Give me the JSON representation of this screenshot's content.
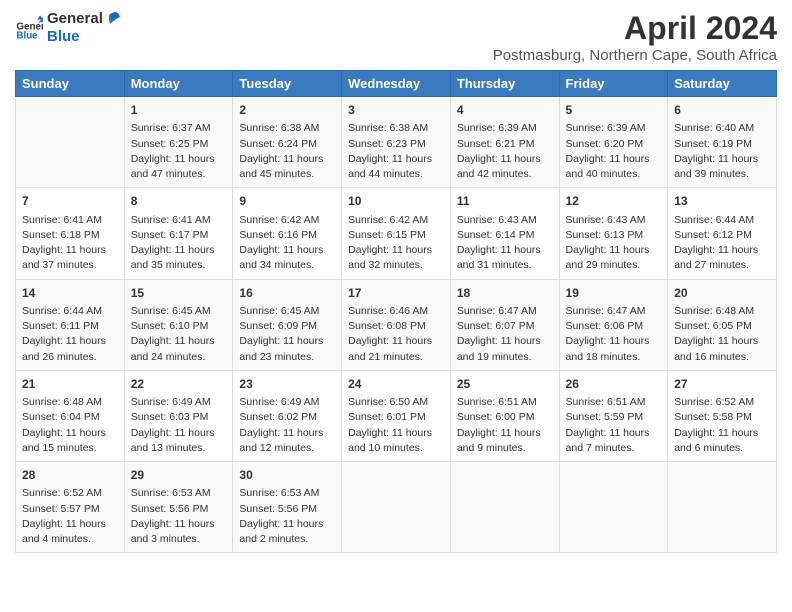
{
  "logo": {
    "text_general": "General",
    "text_blue": "Blue"
  },
  "title": "April 2024",
  "subtitle": "Postmasburg, Northern Cape, South Africa",
  "days_of_week": [
    "Sunday",
    "Monday",
    "Tuesday",
    "Wednesday",
    "Thursday",
    "Friday",
    "Saturday"
  ],
  "weeks": [
    [
      {
        "day": "",
        "info": ""
      },
      {
        "day": "1",
        "info": "Sunrise: 6:37 AM\nSunset: 6:25 PM\nDaylight: 11 hours\nand 47 minutes."
      },
      {
        "day": "2",
        "info": "Sunrise: 6:38 AM\nSunset: 6:24 PM\nDaylight: 11 hours\nand 45 minutes."
      },
      {
        "day": "3",
        "info": "Sunrise: 6:38 AM\nSunset: 6:23 PM\nDaylight: 11 hours\nand 44 minutes."
      },
      {
        "day": "4",
        "info": "Sunrise: 6:39 AM\nSunset: 6:21 PM\nDaylight: 11 hours\nand 42 minutes."
      },
      {
        "day": "5",
        "info": "Sunrise: 6:39 AM\nSunset: 6:20 PM\nDaylight: 11 hours\nand 40 minutes."
      },
      {
        "day": "6",
        "info": "Sunrise: 6:40 AM\nSunset: 6:19 PM\nDaylight: 11 hours\nand 39 minutes."
      }
    ],
    [
      {
        "day": "7",
        "info": "Sunrise: 6:41 AM\nSunset: 6:18 PM\nDaylight: 11 hours\nand 37 minutes."
      },
      {
        "day": "8",
        "info": "Sunrise: 6:41 AM\nSunset: 6:17 PM\nDaylight: 11 hours\nand 35 minutes."
      },
      {
        "day": "9",
        "info": "Sunrise: 6:42 AM\nSunset: 6:16 PM\nDaylight: 11 hours\nand 34 minutes."
      },
      {
        "day": "10",
        "info": "Sunrise: 6:42 AM\nSunset: 6:15 PM\nDaylight: 11 hours\nand 32 minutes."
      },
      {
        "day": "11",
        "info": "Sunrise: 6:43 AM\nSunset: 6:14 PM\nDaylight: 11 hours\nand 31 minutes."
      },
      {
        "day": "12",
        "info": "Sunrise: 6:43 AM\nSunset: 6:13 PM\nDaylight: 11 hours\nand 29 minutes."
      },
      {
        "day": "13",
        "info": "Sunrise: 6:44 AM\nSunset: 6:12 PM\nDaylight: 11 hours\nand 27 minutes."
      }
    ],
    [
      {
        "day": "14",
        "info": "Sunrise: 6:44 AM\nSunset: 6:11 PM\nDaylight: 11 hours\nand 26 minutes."
      },
      {
        "day": "15",
        "info": "Sunrise: 6:45 AM\nSunset: 6:10 PM\nDaylight: 11 hours\nand 24 minutes."
      },
      {
        "day": "16",
        "info": "Sunrise: 6:45 AM\nSunset: 6:09 PM\nDaylight: 11 hours\nand 23 minutes."
      },
      {
        "day": "17",
        "info": "Sunrise: 6:46 AM\nSunset: 6:08 PM\nDaylight: 11 hours\nand 21 minutes."
      },
      {
        "day": "18",
        "info": "Sunrise: 6:47 AM\nSunset: 6:07 PM\nDaylight: 11 hours\nand 19 minutes."
      },
      {
        "day": "19",
        "info": "Sunrise: 6:47 AM\nSunset: 6:06 PM\nDaylight: 11 hours\nand 18 minutes."
      },
      {
        "day": "20",
        "info": "Sunrise: 6:48 AM\nSunset: 6:05 PM\nDaylight: 11 hours\nand 16 minutes."
      }
    ],
    [
      {
        "day": "21",
        "info": "Sunrise: 6:48 AM\nSunset: 6:04 PM\nDaylight: 11 hours\nand 15 minutes."
      },
      {
        "day": "22",
        "info": "Sunrise: 6:49 AM\nSunset: 6:03 PM\nDaylight: 11 hours\nand 13 minutes."
      },
      {
        "day": "23",
        "info": "Sunrise: 6:49 AM\nSunset: 6:02 PM\nDaylight: 11 hours\nand 12 minutes."
      },
      {
        "day": "24",
        "info": "Sunrise: 6:50 AM\nSunset: 6:01 PM\nDaylight: 11 hours\nand 10 minutes."
      },
      {
        "day": "25",
        "info": "Sunrise: 6:51 AM\nSunset: 6:00 PM\nDaylight: 11 hours\nand 9 minutes."
      },
      {
        "day": "26",
        "info": "Sunrise: 6:51 AM\nSunset: 5:59 PM\nDaylight: 11 hours\nand 7 minutes."
      },
      {
        "day": "27",
        "info": "Sunrise: 6:52 AM\nSunset: 5:58 PM\nDaylight: 11 hours\nand 6 minutes."
      }
    ],
    [
      {
        "day": "28",
        "info": "Sunrise: 6:52 AM\nSunset: 5:57 PM\nDaylight: 11 hours\nand 4 minutes."
      },
      {
        "day": "29",
        "info": "Sunrise: 6:53 AM\nSunset: 5:56 PM\nDaylight: 11 hours\nand 3 minutes."
      },
      {
        "day": "30",
        "info": "Sunrise: 6:53 AM\nSunset: 5:56 PM\nDaylight: 11 hours\nand 2 minutes."
      },
      {
        "day": "",
        "info": ""
      },
      {
        "day": "",
        "info": ""
      },
      {
        "day": "",
        "info": ""
      },
      {
        "day": "",
        "info": ""
      }
    ]
  ]
}
